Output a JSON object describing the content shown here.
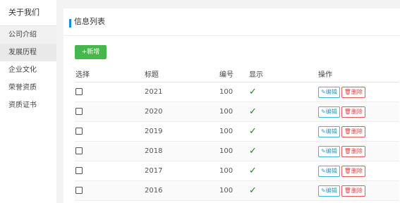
{
  "sidebar": {
    "header": "关于我们",
    "items": [
      {
        "label": "公司介绍"
      },
      {
        "label": "发展历程"
      },
      {
        "label": "企业文化"
      },
      {
        "label": "荣誉资质"
      },
      {
        "label": "资质证书"
      }
    ]
  },
  "panel": {
    "title": "信息列表",
    "add_label": "+新增"
  },
  "table": {
    "headers": [
      "选择",
      "标题",
      "编号",
      "显示",
      "操作"
    ],
    "edit_label": "编辑",
    "delete_label": "删除",
    "check_mark": "✓",
    "rows": [
      {
        "title": "2021",
        "number": "100"
      },
      {
        "title": "2020",
        "number": "100"
      },
      {
        "title": "2019",
        "number": "100"
      },
      {
        "title": "2018",
        "number": "100"
      },
      {
        "title": "2017",
        "number": "100"
      },
      {
        "title": "2016",
        "number": "100"
      }
    ]
  },
  "colors": {
    "accent": "#0e8ce8",
    "add": "#46b74a",
    "edit": "#45b4d6",
    "delete": "#e05c5c",
    "check": "#1a8f1a"
  }
}
